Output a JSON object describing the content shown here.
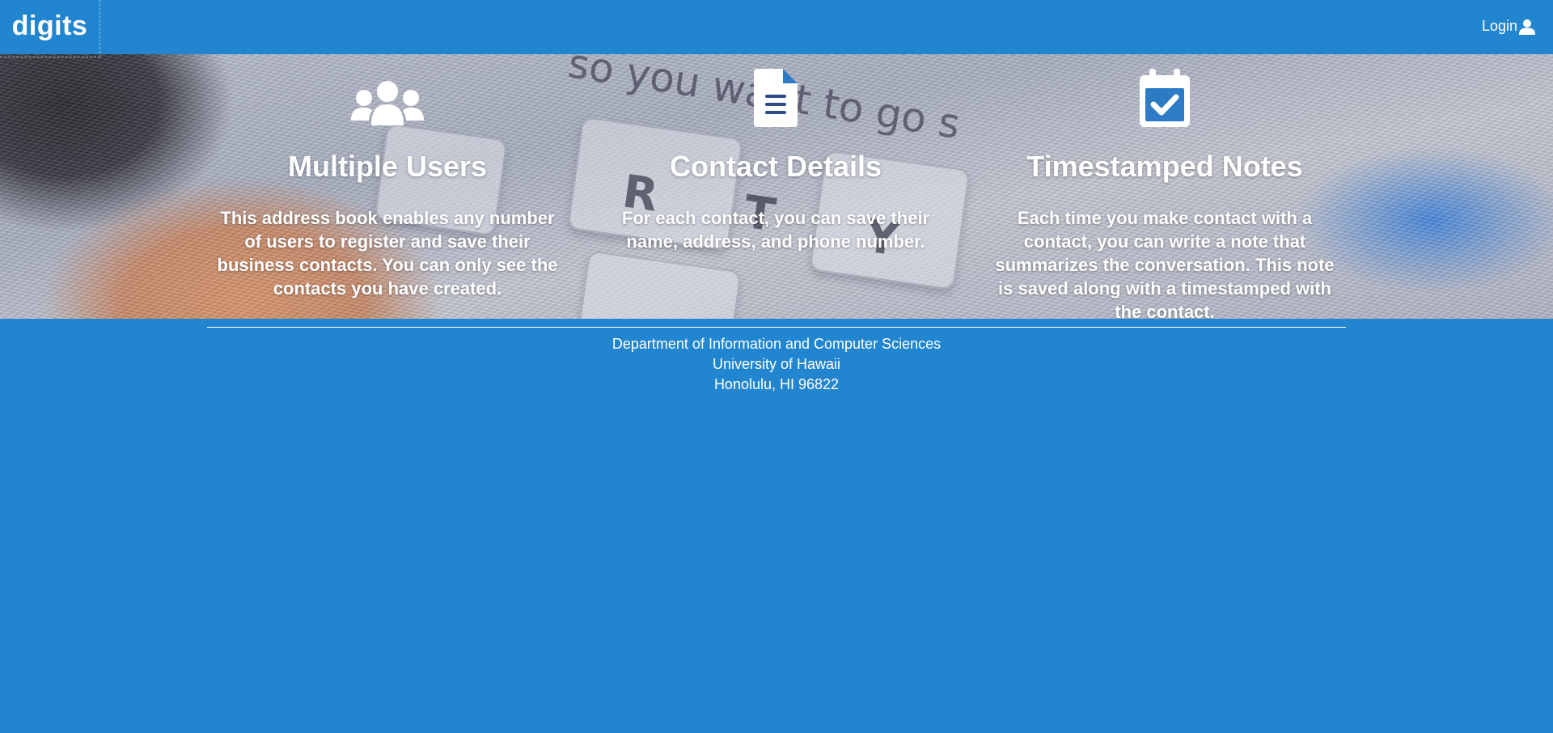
{
  "navbar": {
    "brand": "digits",
    "login_label": "Login",
    "login_icon": "user-icon"
  },
  "features": [
    {
      "icon": "users-icon",
      "title": "Multiple Users",
      "text": "This address book enables any number of users to register and save their business contacts. You can only see the contacts you have created."
    },
    {
      "icon": "file-text-icon",
      "title": "Contact Details",
      "text": "For each contact, you can save their name, address, and phone number."
    },
    {
      "icon": "calendar-check-icon",
      "title": "Timestamped Notes",
      "text": "Each time you make contact with a contact, you can write a note that summarizes the conversation. This note is saved along with a timestamped with the contact."
    }
  ],
  "footer": {
    "line1": "Department of Information and Computer Sciences",
    "line2": "University of Hawaii",
    "line3": "Honolulu, HI 96822"
  },
  "colors": {
    "primary": "#2185d0",
    "text": "#ffffff"
  }
}
